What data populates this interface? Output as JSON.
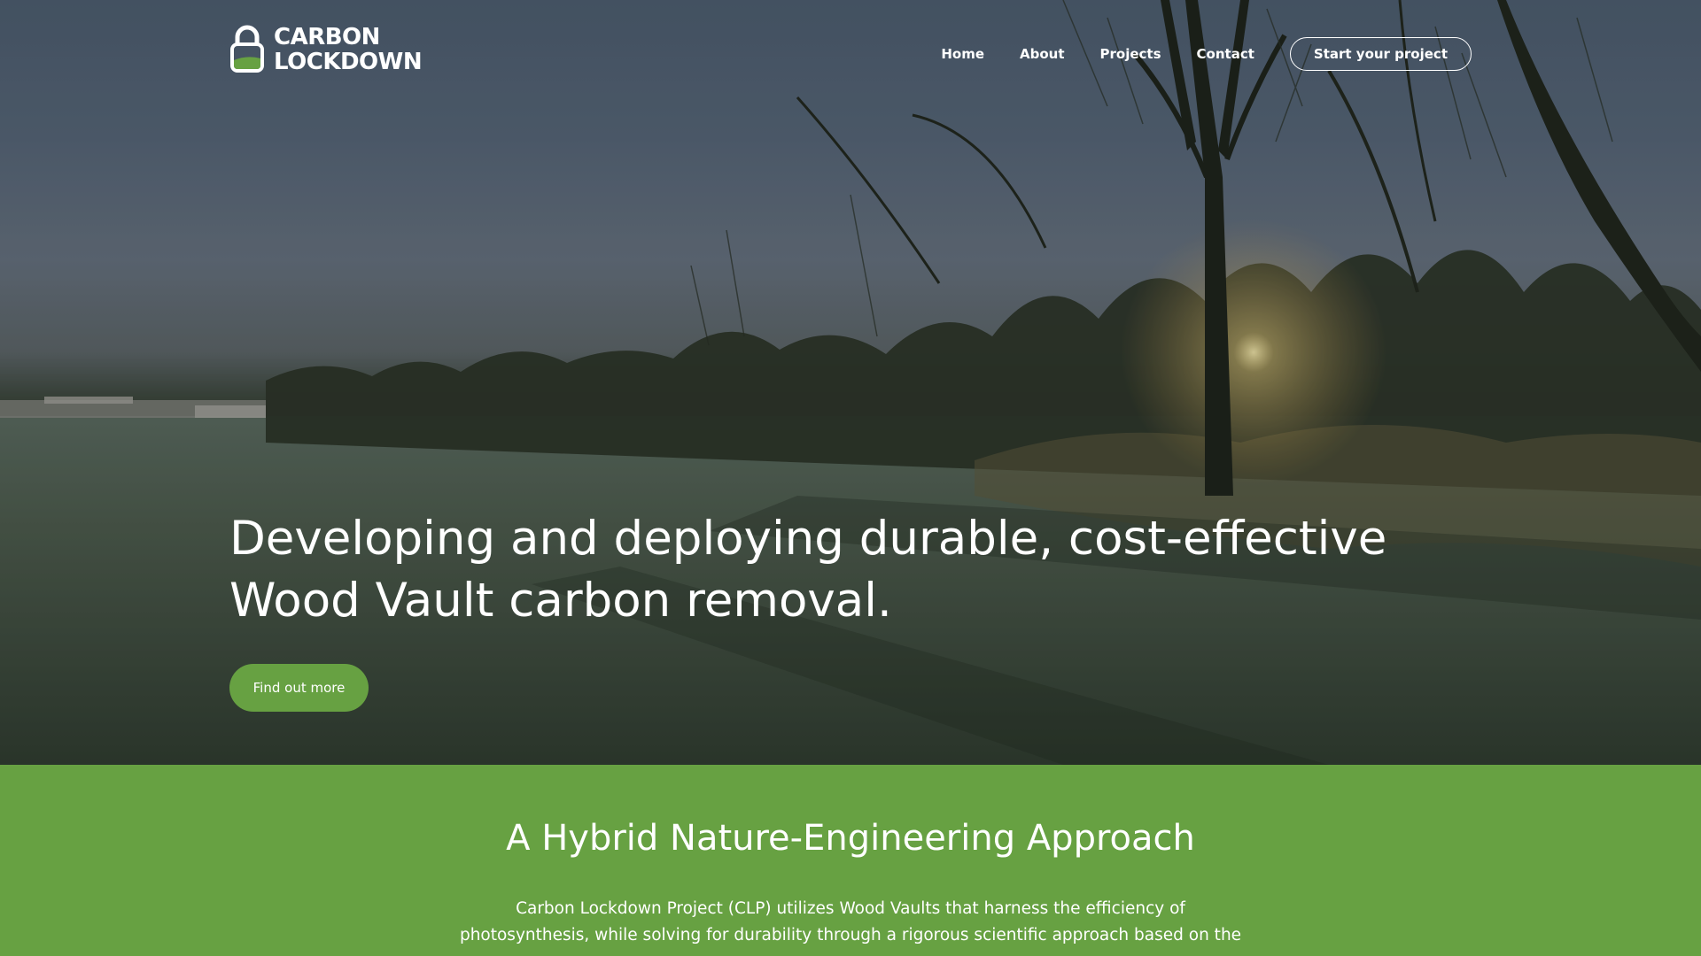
{
  "brand": {
    "line1": "CARBON",
    "line2": "LOCKDOWN",
    "logo_icon": "padlock-icon"
  },
  "nav": {
    "items": [
      {
        "label": "Home"
      },
      {
        "label": "About"
      },
      {
        "label": "Projects"
      },
      {
        "label": "Contact"
      }
    ],
    "cta_label": "Start your project"
  },
  "hero": {
    "title": "Developing and deploying durable, cost-effective Wood Vault carbon removal.",
    "button_label": "Find out more"
  },
  "approach": {
    "title": "A Hybrid Nature-Engineering Approach",
    "body": "Carbon Lockdown Project (CLP) utilizes Wood Vaults that harness the efficiency of photosynthesis, while solving for durability through a rigorous scientific approach based on the"
  },
  "colors": {
    "accent": "#67a142",
    "text_on_dark": "#ffffff"
  }
}
